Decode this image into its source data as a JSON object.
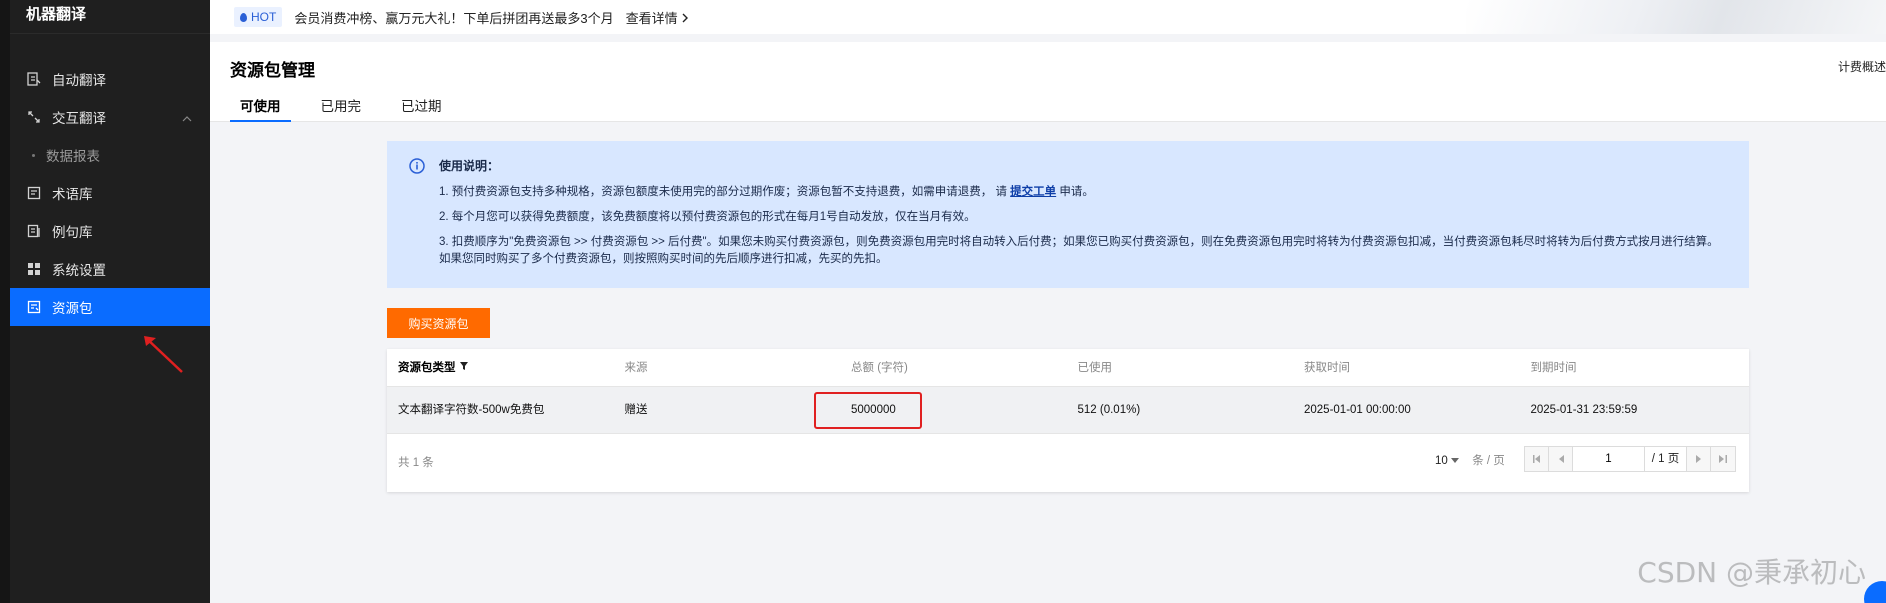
{
  "sidebar": {
    "brand": "机器翻译",
    "items": [
      {
        "label": "自动翻译",
        "icon": "doc-translate-icon"
      },
      {
        "label": "交互翻译",
        "icon": "interactive-icon"
      },
      {
        "label": "数据报表",
        "icon": ""
      },
      {
        "label": "术语库",
        "icon": "glossary-icon"
      },
      {
        "label": "例句库",
        "icon": "example-icon"
      },
      {
        "label": "系统设置",
        "icon": "grid-icon"
      },
      {
        "label": "资源包",
        "icon": "package-icon"
      }
    ]
  },
  "banner": {
    "badge": "HOT",
    "text": "会员消费冲榜、赢万元大礼！下单后拼团再送最多3个月",
    "link": "查看详情"
  },
  "page": {
    "title": "资源包管理",
    "billing_link": "计费概述",
    "tabs": [
      "可使用",
      "已用完",
      "已过期"
    ]
  },
  "notice": {
    "title": "使用说明：",
    "line1_pre": "1. 预付费资源包支持多种规格，资源包额度未使用完的部分过期作废；资源包暂不支持退费，如需申请退费，  请 ",
    "line1_link": "提交工单",
    "line1_post": " 申请。",
    "line2": "2. 每个月您可以获得免费额度，该免费额度将以预付费资源包的形式在每月1号自动发放，仅在当月有效。",
    "line3": "3. 扣费顺序为\"免费资源包 >> 付费资源包 >> 后付费\"。如果您未购买付费资源包，则免费资源包用完时将自动转入后付费；如果您已购买付费资源包，则在免费资源包用完时将转为付费资源包扣减，当付费资源包耗尽时将转为后付费方式按月进行结算。如果您同时购买了多个付费资源包，则按照购买时间的先后顺序进行扣减，先买的先扣。"
  },
  "buy_button": "购买资源包",
  "table": {
    "headers": [
      "资源包类型",
      "来源",
      "总额 (字符)",
      "已使用",
      "获取时间",
      "到期时间"
    ],
    "rows": [
      [
        "文本翻译字符数-500w免费包",
        "赠送",
        "5000000",
        "512 (0.01%)",
        "2025-01-01 00:00:00",
        "2025-01-31 23:59:59"
      ]
    ],
    "total_text": "共 1 条",
    "page_size": "10",
    "page_size_unit": "条 / 页",
    "current_page": "1",
    "total_pages": "/ 1 页"
  },
  "watermark": "CSDN @秉承初心",
  "colors": {
    "accent": "#0a6cff",
    "buy": "#ff6a00",
    "highlight": "#e02020",
    "notice_bg": "#d8e7ff"
  }
}
